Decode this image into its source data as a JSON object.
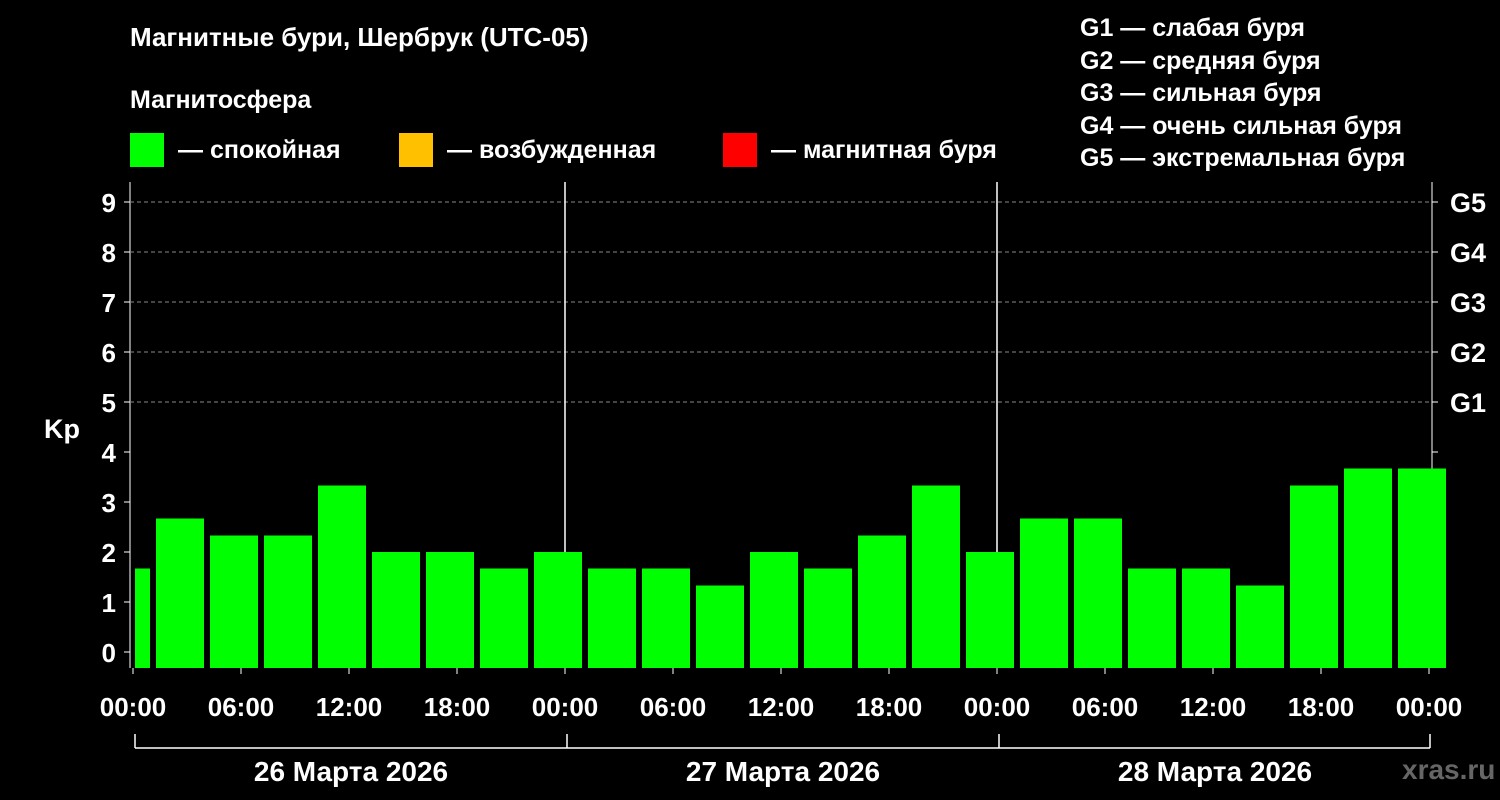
{
  "title": "Магнитные бури, Шербрук (UTC-05)",
  "subtitle": "Магнитосфера",
  "legend": [
    {
      "color": "#00ff00",
      "label": "— спокойная"
    },
    {
      "color": "#ffc000",
      "label": "— возбужденная"
    },
    {
      "color": "#ff0000",
      "label": "— магнитная буря"
    }
  ],
  "g_legend": [
    "G1 — слабая буря",
    "G2 — средняя буря",
    "G3 — сильная буря",
    "G4 — очень сильная буря",
    "G5 — экстремальная буря"
  ],
  "watermark": "xras.ru",
  "chart_data": {
    "type": "bar",
    "ylabel": "Kp",
    "ylim": [
      0,
      9
    ],
    "yticks": [
      "0",
      "1",
      "2",
      "3",
      "4",
      "5",
      "6",
      "7",
      "8",
      "9"
    ],
    "g_scale": [
      {
        "label": "G1",
        "kp": 5
      },
      {
        "label": "G2",
        "kp": 6
      },
      {
        "label": "G3",
        "kp": 7
      },
      {
        "label": "G4",
        "kp": 8
      },
      {
        "label": "G5",
        "kp": 9
      }
    ],
    "x_ticks": [
      "00:00",
      "06:00",
      "12:00",
      "18:00",
      "00:00",
      "06:00",
      "12:00",
      "18:00",
      "00:00",
      "06:00",
      "12:00",
      "18:00",
      "00:00"
    ],
    "days": [
      "26 Марта 2026",
      "27 Марта 2026",
      "28 Марта 2026"
    ],
    "bar_color": "#00ff00",
    "series": [
      {
        "values": [
          1.67,
          2.67,
          2.33,
          2.33,
          3.33,
          2.0,
          2.0,
          1.67,
          2.0,
          1.67,
          1.67,
          1.33,
          2.0,
          1.67,
          2.33,
          3.33,
          2.0,
          2.67,
          2.67,
          1.67,
          1.67,
          1.33,
          3.33,
          3.67,
          3.67
        ]
      }
    ]
  }
}
